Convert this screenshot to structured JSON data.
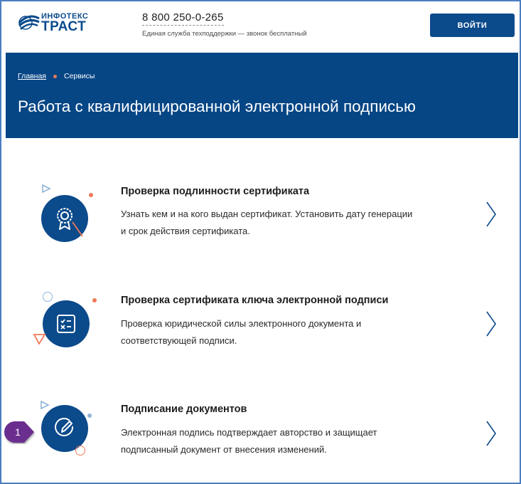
{
  "header": {
    "logo_top": "ИНФОТЕКС",
    "logo_main": "ТРАСТ",
    "phone": "8 800 250-0-265",
    "support_text": "Единая служба техподдержки — звонок бесплатный",
    "login_label": "ВОЙТИ"
  },
  "breadcrumb": {
    "home": "Главная",
    "current": "Сервисы"
  },
  "page_title": "Работа с квалифицированной электронной подписью",
  "services": [
    {
      "title": "Проверка подлинности сертификата",
      "desc_line1": "Узнать кем и на кого выдан сертификат. Установить дату генерации",
      "desc_line2": "и срок действия сертификата.",
      "icon": "certificate-award-icon"
    },
    {
      "title": "Проверка сертификата ключа электронной подписи",
      "desc_line1": "Проверка юридической силы электронного документа и",
      "desc_line2": "соответствующей подписи.",
      "icon": "checklist-icon"
    },
    {
      "title": "Подписание документов",
      "desc_line1": "Электронная подпись подтверждает авторство и защищает",
      "desc_line2": "подписанный документ от внесения изменений.",
      "icon": "edit-pen-icon"
    }
  ],
  "callout": {
    "number": "1"
  },
  "colors": {
    "brand_blue": "#064685",
    "accent_coral": "#f07a56",
    "light_blue": "#8fb4d6",
    "callout_purple": "#6b2d8f"
  }
}
